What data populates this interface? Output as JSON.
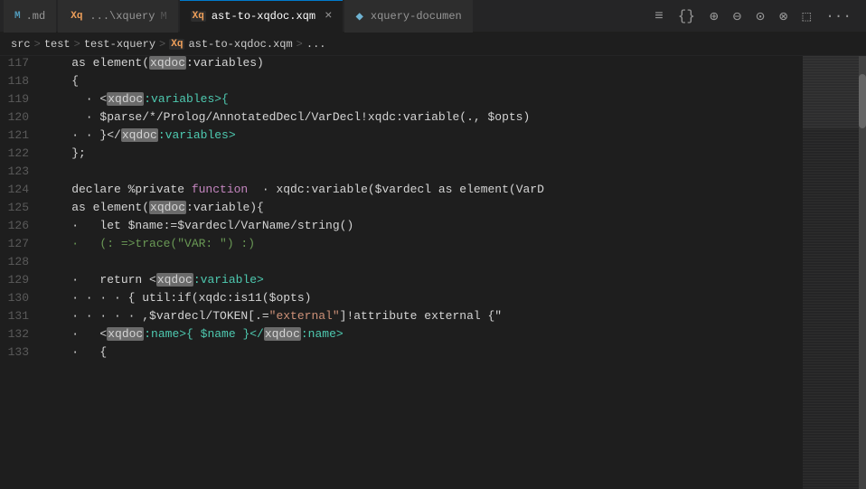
{
  "tabs": [
    {
      "id": "md-tab",
      "icon_type": "md",
      "icon_label": "M",
      "label": ".md",
      "active": false,
      "closeable": false,
      "pinned": false
    },
    {
      "id": "xquery-tab1",
      "icon_type": "xq",
      "icon_label": "Xq",
      "label": "...\\xquery",
      "active": false,
      "closeable": false,
      "pinned": false
    },
    {
      "id": "ast-tab",
      "icon_type": "xq",
      "icon_label": "Xq",
      "label": "ast-to-xqdoc.xqm",
      "active": true,
      "closeable": true,
      "pinned": false
    },
    {
      "id": "xquery-doc-tab",
      "icon_type": "pinned",
      "icon_label": "◆",
      "label": "xquery-documen",
      "active": false,
      "closeable": false,
      "pinned": true
    }
  ],
  "toolbar": {
    "icons": [
      "≡",
      "{}",
      "⊕",
      "⊖",
      "⊙",
      "⊗",
      "⬚",
      "···"
    ]
  },
  "breadcrumb": {
    "parts": [
      "src",
      "test",
      "test-xquery",
      "Xq ast-to-xqdoc.xqm",
      "..."
    ]
  },
  "lines": [
    {
      "num": "117",
      "tokens": [
        {
          "text": "    as element(",
          "class": "plain"
        },
        {
          "text": "xqdoc",
          "class": "highlight-bg"
        },
        {
          "text": ":variables)",
          "class": "plain"
        }
      ]
    },
    {
      "num": "118",
      "tokens": [
        {
          "text": "    {",
          "class": "plain"
        }
      ]
    },
    {
      "num": "119",
      "tokens": [
        {
          "text": "        <",
          "class": "plain"
        },
        {
          "text": "xqdoc",
          "class": "highlight-bg"
        },
        {
          "text": ":variables>{",
          "class": "tag"
        }
      ]
    },
    {
      "num": "120",
      "tokens": [
        {
          "text": "        $parse/*/Prolog/AnnotatedDecl/VarDecl!xqdc:variable(., $opts)",
          "class": "plain"
        }
      ]
    },
    {
      "num": "121",
      "tokens": [
        {
          "text": "    ·   }</",
          "class": "plain"
        },
        {
          "text": "xqdoc",
          "class": "highlight-bg"
        },
        {
          "text": ":variables>",
          "class": "tag"
        }
      ]
    },
    {
      "num": "122",
      "tokens": [
        {
          "text": "    };",
          "class": "plain"
        }
      ]
    },
    {
      "num": "123",
      "tokens": [
        {
          "text": "",
          "class": "plain"
        }
      ]
    },
    {
      "num": "124",
      "tokens": [
        {
          "text": "    declare %private ",
          "class": "plain"
        },
        {
          "text": "function",
          "class": "kw-fn"
        },
        {
          "text": "   xqdc:variable($vardecl as element(VarD",
          "class": "plain"
        }
      ]
    },
    {
      "num": "125",
      "tokens": [
        {
          "text": "    as element(",
          "class": "plain"
        },
        {
          "text": "xqdoc",
          "class": "highlight-bg"
        },
        {
          "text": ":variable){",
          "class": "plain"
        }
      ]
    },
    {
      "num": "126",
      "tokens": [
        {
          "text": "    ·   let $name:=$vardecl/VarName/string()",
          "class": "plain"
        }
      ]
    },
    {
      "num": "127",
      "tokens": [
        {
          "text": "    ·   (: =>trace(\"VAR: \") :)",
          "class": "comment"
        }
      ]
    },
    {
      "num": "128",
      "tokens": [
        {
          "text": "",
          "class": "plain"
        }
      ]
    },
    {
      "num": "129",
      "tokens": [
        {
          "text": "    ·   return <",
          "class": "plain"
        },
        {
          "text": "xqdoc",
          "class": "highlight-bg"
        },
        {
          "text": ":variable>",
          "class": "tag"
        }
      ]
    },
    {
      "num": "130",
      "tokens": [
        {
          "text": "    · · · · { util:if(xqdc:is11($opts)",
          "class": "plain"
        }
      ]
    },
    {
      "num": "131",
      "tokens": [
        {
          "text": "    · · · · · ,$vardecl/TOKEN[.=",
          "class": "plain"
        },
        {
          "text": "\"external\"",
          "class": "str"
        },
        {
          "text": "]!attribute external {\"",
          "class": "plain"
        }
      ]
    },
    {
      "num": "132",
      "tokens": [
        {
          "text": "    ·   <",
          "class": "plain"
        },
        {
          "text": "xqdoc",
          "class": "highlight-bg"
        },
        {
          "text": ":name>{ $name }</",
          "class": "tag"
        },
        {
          "text": "xqdoc",
          "class": "highlight-bg"
        },
        {
          "text": ":name>",
          "class": "tag"
        }
      ]
    },
    {
      "num": "133",
      "tokens": [
        {
          "text": "    ·   {",
          "class": "plain"
        }
      ]
    }
  ]
}
